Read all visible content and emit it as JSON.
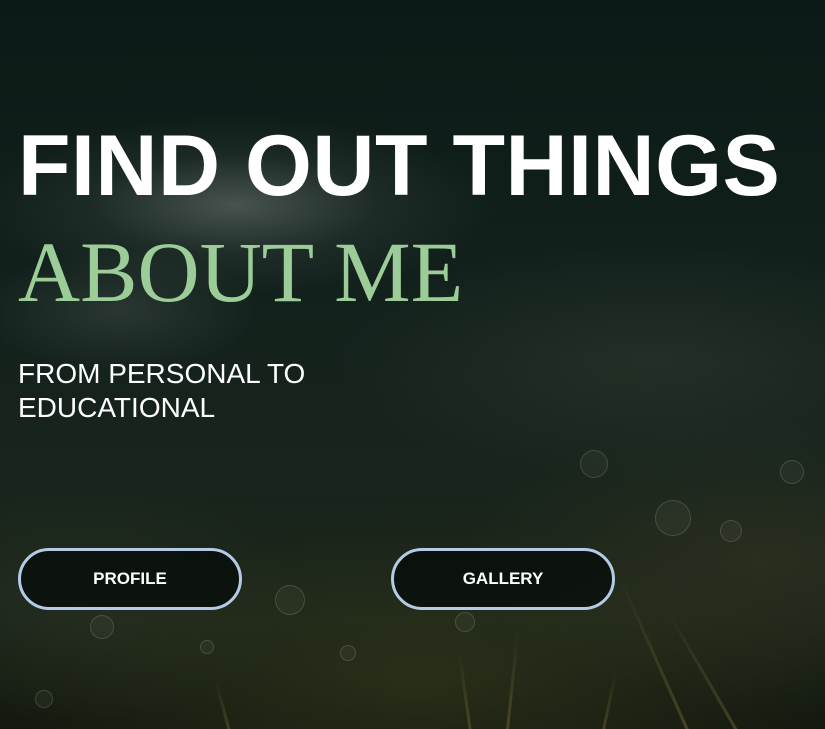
{
  "hero": {
    "headline": "FIND OUT THINGS",
    "headline_accent": "ABOUT ME",
    "subtitle": "FROM PERSONAL TO EDUCATIONAL"
  },
  "buttons": {
    "profile_label": "PROFILE",
    "gallery_label": "GALLERY"
  },
  "colors": {
    "accent_green": "#9ccc97",
    "button_border": "#b4cbe6",
    "text": "#ffffff",
    "background": "#0b1512"
  }
}
